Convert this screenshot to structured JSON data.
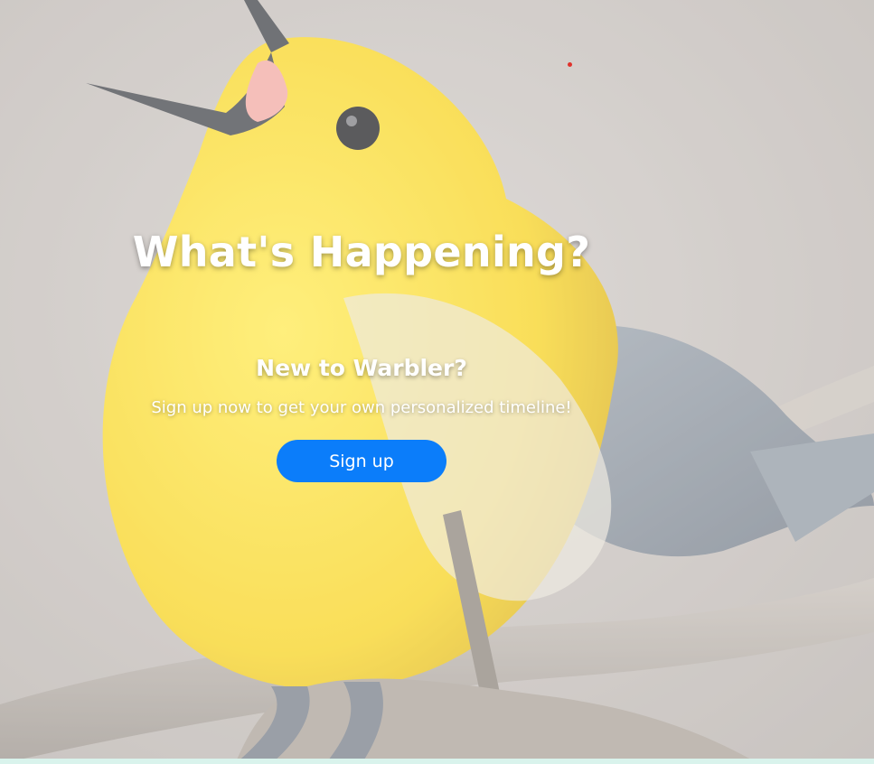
{
  "hero": {
    "background_image": "yellow-warbler-bird-photo",
    "headline": "What's Happening?",
    "subheading": "New to Warbler?",
    "tagline": "Sign up now to get your own personalized timeline!",
    "signup_label": "Sign up"
  },
  "colors": {
    "button_bg": "#0b7dfa",
    "text": "#ffffff",
    "accent_dot": "#e0322b",
    "footer_strip": "#d9f3ec"
  }
}
